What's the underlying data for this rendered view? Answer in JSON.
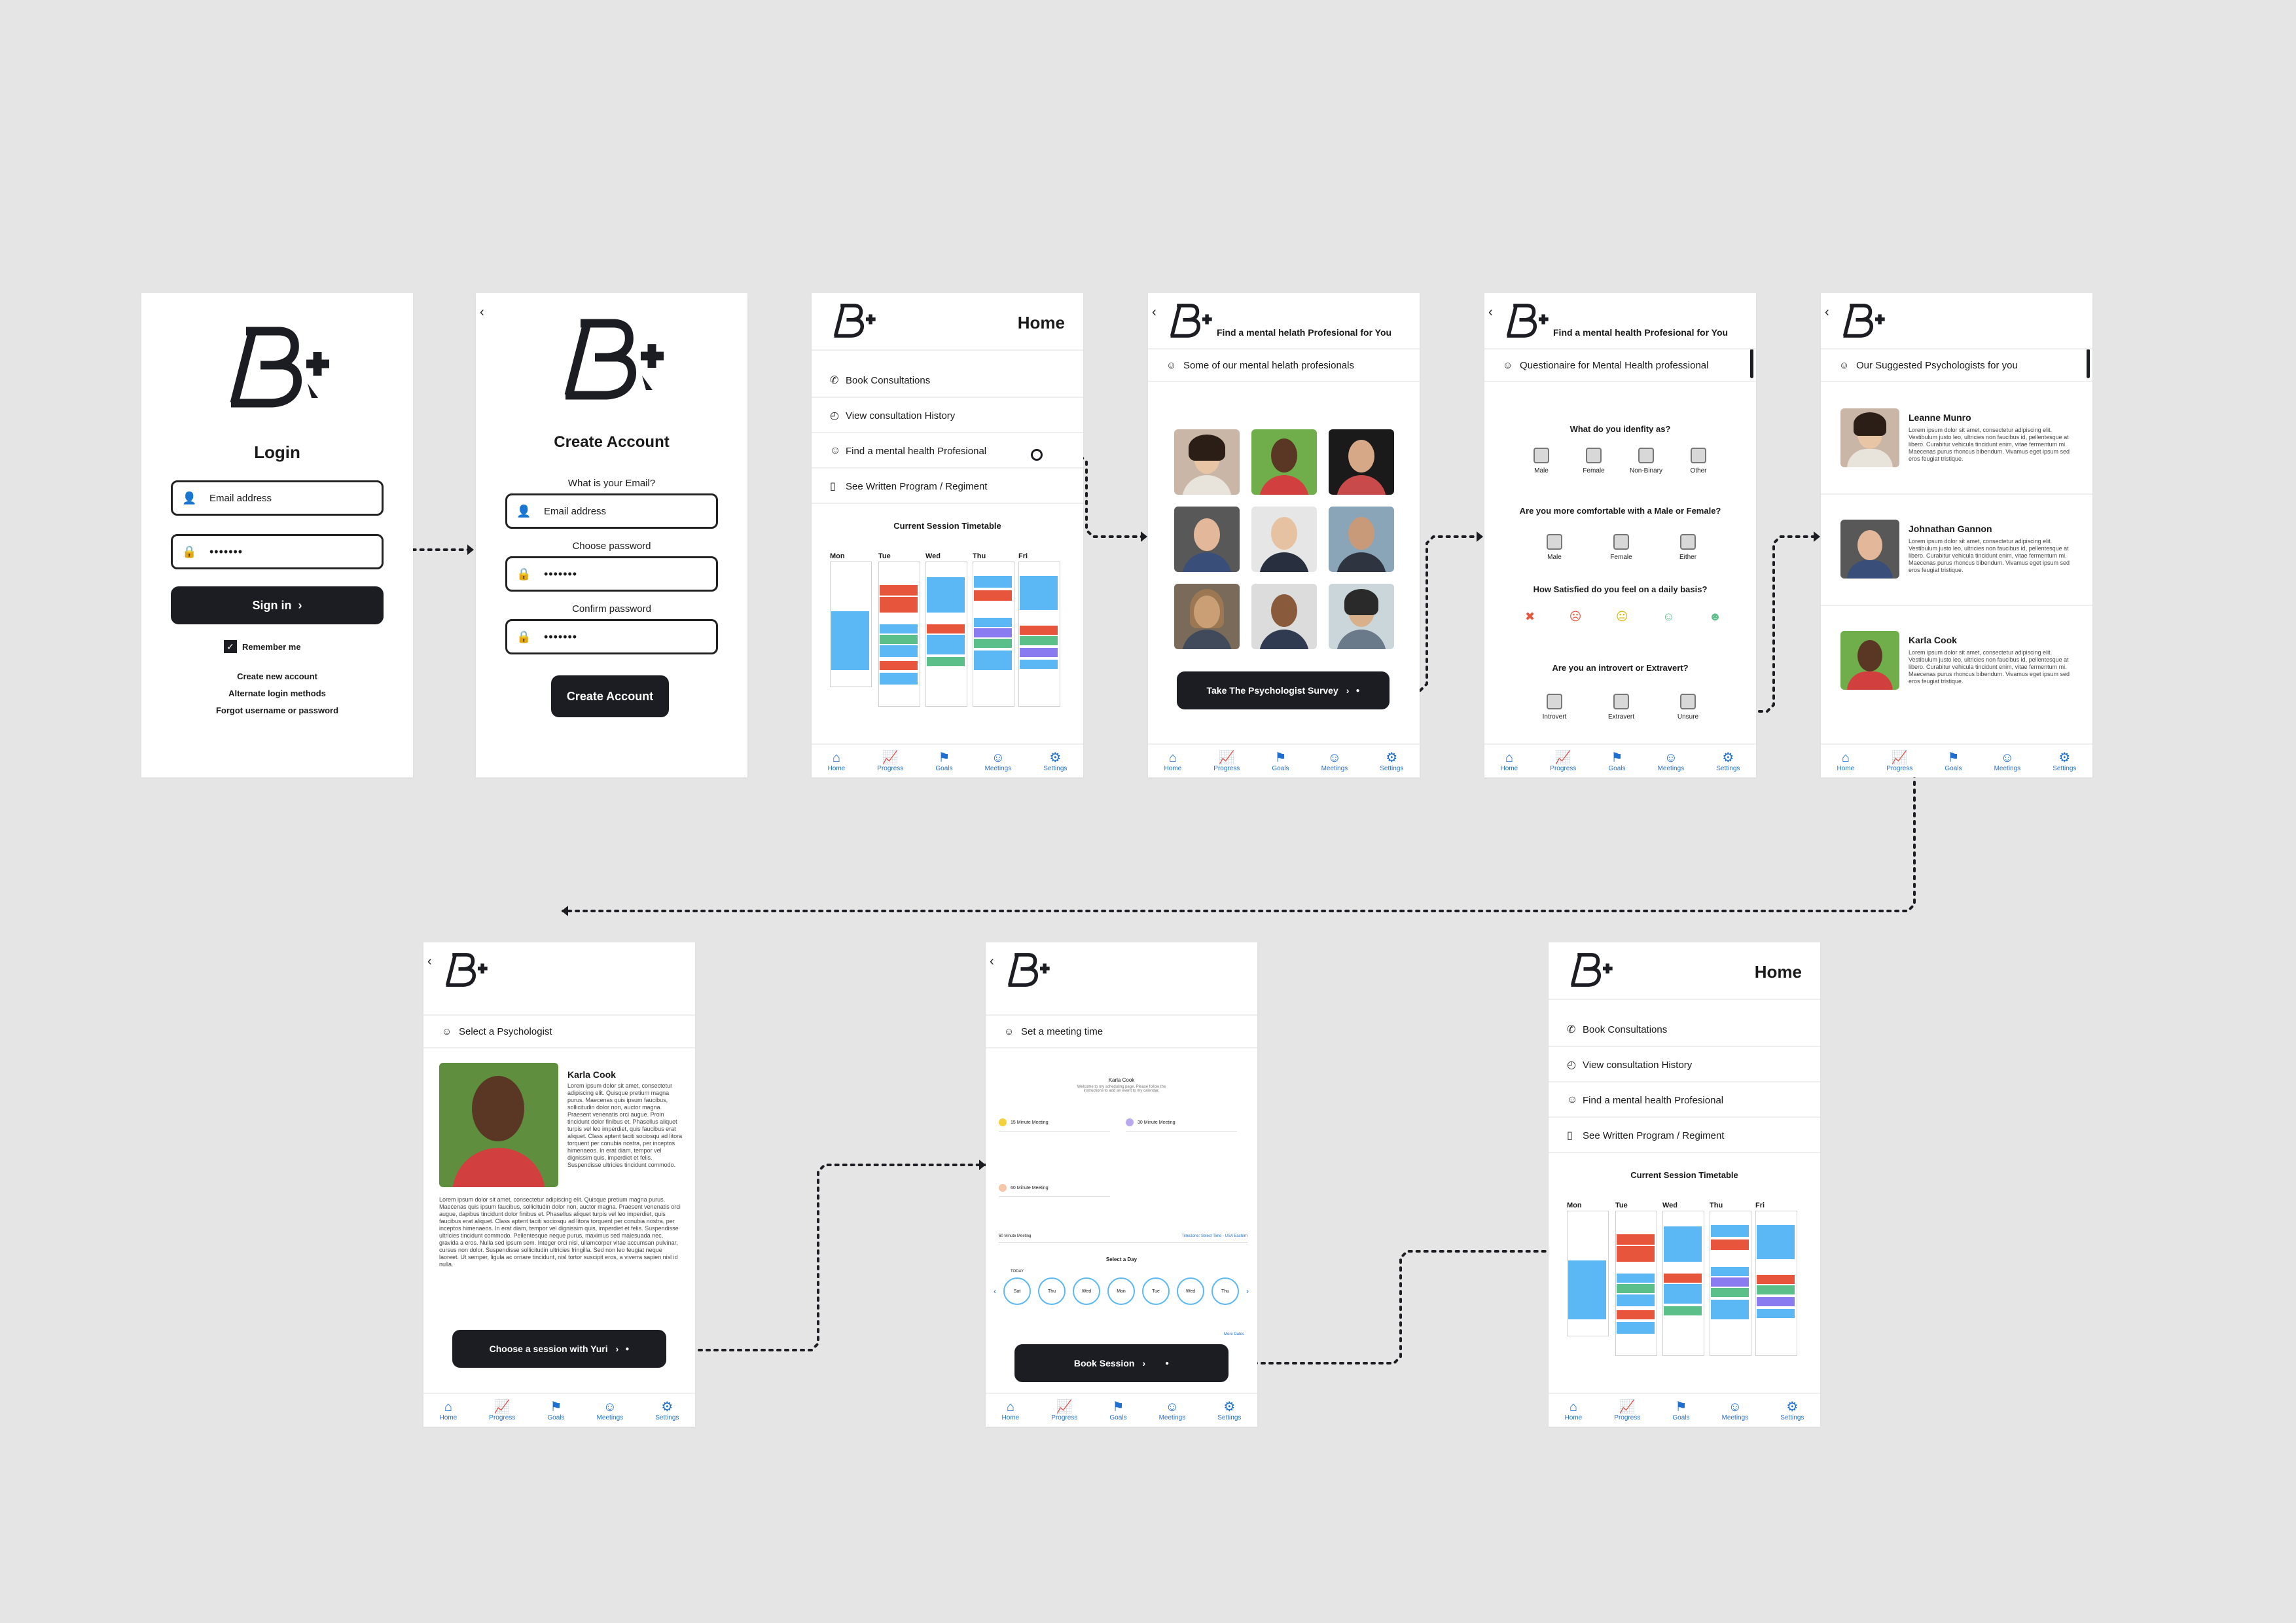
{
  "brand": {
    "logo_text": "B+"
  },
  "tabs": [
    {
      "label": "Home",
      "icon": "home-icon"
    },
    {
      "label": "Progress",
      "icon": "chart-icon"
    },
    {
      "label": "Goals",
      "icon": "award-icon"
    },
    {
      "label": "Meetings",
      "icon": "smile-icon"
    },
    {
      "label": "Settings",
      "icon": "gear-icon"
    }
  ],
  "login": {
    "title": "Login",
    "email_placeholder": "Email address",
    "password_mask": "•••••••",
    "signin_label": "Sign in",
    "remember_label": "Remember me",
    "create_link": "Create new account",
    "alt_login": "Alternate login methods",
    "forgot": "Forgot username or password"
  },
  "create": {
    "title": "Create Account",
    "email_q": "What is your Email?",
    "email_placeholder": "Email address",
    "choose_pw": "Choose password",
    "confirm_pw": "Confirm password",
    "password_mask": "•••••••",
    "button": "Create Account"
  },
  "home": {
    "title": "Home",
    "menu": [
      "Book Consultations",
      "View consultation History",
      "Find a mental health Profesional",
      "See Written Program / Regiment"
    ],
    "timetable_title": "Current Session Timetable",
    "days": [
      "Mon",
      "Tue",
      "Wed",
      "Thu",
      "Fri"
    ]
  },
  "find": {
    "title": "Find a mental helath Profesional for You",
    "section": "Some of our mental helath profesionals",
    "button": "Take The Psychologist Survey"
  },
  "survey": {
    "title": "Find a mental health Profesional for You",
    "section": "Questionaire for Mental Health professional",
    "q1": "What do you idenfity as?",
    "q1_opts": [
      "Male",
      "Female",
      "Non-Binary",
      "Other"
    ],
    "q2": "Are you more comfortable with a Male or Female?",
    "q2_opts": [
      "Male",
      "Female",
      "Either"
    ],
    "q3": "How Satisfied do you feel on a daily basis?",
    "q4": "Are you an introvert or Extravert?",
    "q4_opts": [
      "Introvert",
      "Extravert",
      "Unsure"
    ]
  },
  "suggested": {
    "section": "Our Suggested Psychologists for you",
    "people": [
      {
        "name": "Leanne Munro"
      },
      {
        "name": "Johnathan Gannon"
      },
      {
        "name": "Karla Cook"
      }
    ],
    "lorem": "Lorem ipsum dolor sit amet, consectetur adipiscing elit. Vestibulum justo leo, ultricies non faucibus id, pellentesque at libero. Curabitur vehicula tincidunt enim, vitae fermentum mi. Maecenas purus rhoncus bibendum. Vivamus eget ipsum sed eros feugiat tristique."
  },
  "select": {
    "section": "Select a Psychologist",
    "name": "Karla Cook",
    "bio_short": "Lorem ipsum dolor sit amet, consectetur adipiscing elit. Quisque pretium magna purus. Maecenas quis ipsum faucibus, sollicitudin dolor non, auctor magna. Praesent venenatis orci augue. Proin tincidunt dolor finibus et. Phasellus aliquet turpis vel leo imperdiet, quis faucibus erat aliquet. Class aptent taciti sociosqu ad litora torquent per conubia nostra, per inceptos himenaeos. In erat diam, tempor vel dignissim quis, imperdiet et felis. Suspendisse ultricies tincidunt commodo.",
    "bio_long": "Lorem ipsum dolor sit amet, consectetur adipiscing elit. Quisque pretium magna purus. Maecenas quis ipsum faucibus, sollicitudin dolor non, auctor magna. Praesent venenatis orci augue, dapibus tincidunt dolor finibus et. Phasellus aliquet turpis vel leo imperdiet, quis faucibus erat aliquet. Class aptent taciti sociosqu ad litora torquent per conubia nostra, per inceptos himenaeos. In erat diam, tempor vel dignissim quis, imperdiet et felis. Suspendisse ultricies tincidunt commodo. Pellentesque neque purus, maximus sed malesuada nec, gravida a eros. Nulla sed ipsum sem. Integer orci nisl, ullamcorper vitae accumsan pulvinar, cursus non dolor. Suspendisse sollicitudin ultricies fringilla. Sed non leo feugiat neque laoreet. Ut semper, ligula ac ornare tincidunt, nisl tortor suscipit eros, a viverra sapien nisl id nulla.",
    "button": "Choose a session with Yuri"
  },
  "meeting": {
    "section": "Set a meeting time",
    "karla": "Karla Cook",
    "welcome": "Welcome to my scheduling page. Please follow the instructions to add an event to my calendar.",
    "options": [
      "15 Minute Meeting",
      "30 Minute Meeting",
      "60 Minute Meeting"
    ],
    "select_day": "Select a Day",
    "selected_meeting": "60 Minute Meeting",
    "timezone": "Timezone: Select Time - USA Eastern",
    "today_label": "TODAY",
    "days": [
      "Sat",
      "Thu",
      "Wed",
      "Mon",
      "Tue",
      "Wed",
      "Thu"
    ],
    "more": "More Dates",
    "button": "Book Session"
  },
  "colors": {
    "accent_blue": "#1e6fd0",
    "cal_blue": "#5bb8f5",
    "cal_red": "#e8553d",
    "cal_green": "#5bbf8a",
    "cal_purple": "#8a7cf0",
    "dark": "#1c1d22"
  }
}
